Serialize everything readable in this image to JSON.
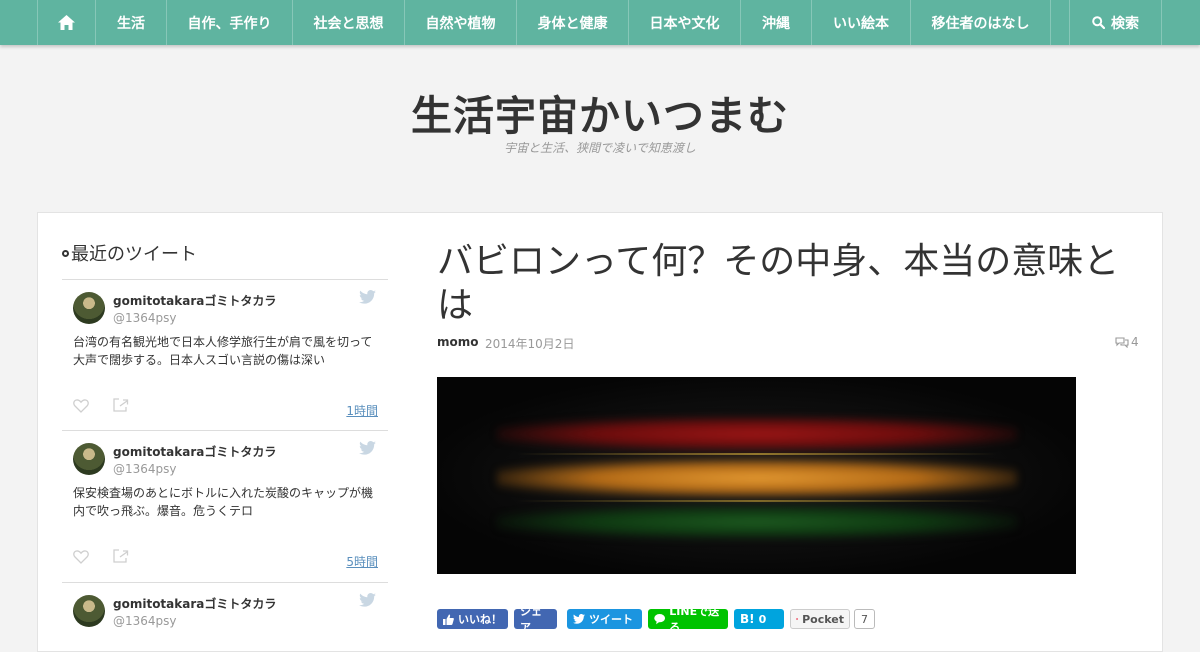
{
  "nav": {
    "home_icon": "home-icon",
    "items": [
      {
        "label": "生活"
      },
      {
        "label": "自作、手作り"
      },
      {
        "label": "社会と思想"
      },
      {
        "label": "自然や植物"
      },
      {
        "label": "身体と健康"
      },
      {
        "label": "日本や文化"
      },
      {
        "label": "沖縄"
      },
      {
        "label": "いい絵本"
      },
      {
        "label": "移住者のはなし"
      }
    ],
    "search_label": "検索",
    "search_icon": "search-icon",
    "color": "#5fb4a0"
  },
  "site": {
    "title": "生活宇宙かいつまむ",
    "tagline": "宇宙と生活、狭間で凌いで知恵渡し"
  },
  "sidebar": {
    "heading": "最近のツイート",
    "tweets": [
      {
        "name": "gomitotakaraゴミトタカラ",
        "handle": "@1364psy",
        "text": "台湾の有名観光地で日本人修学旅行生が肩で風を切って大声で闊歩する。日本人スゴい言説の傷は深い",
        "time": "1時間"
      },
      {
        "name": "gomitotakaraゴミトタカラ",
        "handle": "@1364psy",
        "text": "保安検査場のあとにボトルに入れた炭酸のキャップが機内で吹っ飛ぶ。爆音。危うくテロ",
        "time": "5時間"
      },
      {
        "name": "gomitotakaraゴミトタカラ",
        "handle": "@1364psy",
        "text": "",
        "time": ""
      }
    ]
  },
  "article": {
    "title": "バビロンって何？その中身、本当の意味とは",
    "author": "momo",
    "date": "2014年10月2日",
    "comments": "4"
  },
  "share": {
    "like": "いいね！",
    "share": "シェア",
    "tweet": "ツイート",
    "line": "LINEで送る",
    "hatena_count": "0",
    "pocket": "Pocket",
    "pocket_count": "7"
  }
}
